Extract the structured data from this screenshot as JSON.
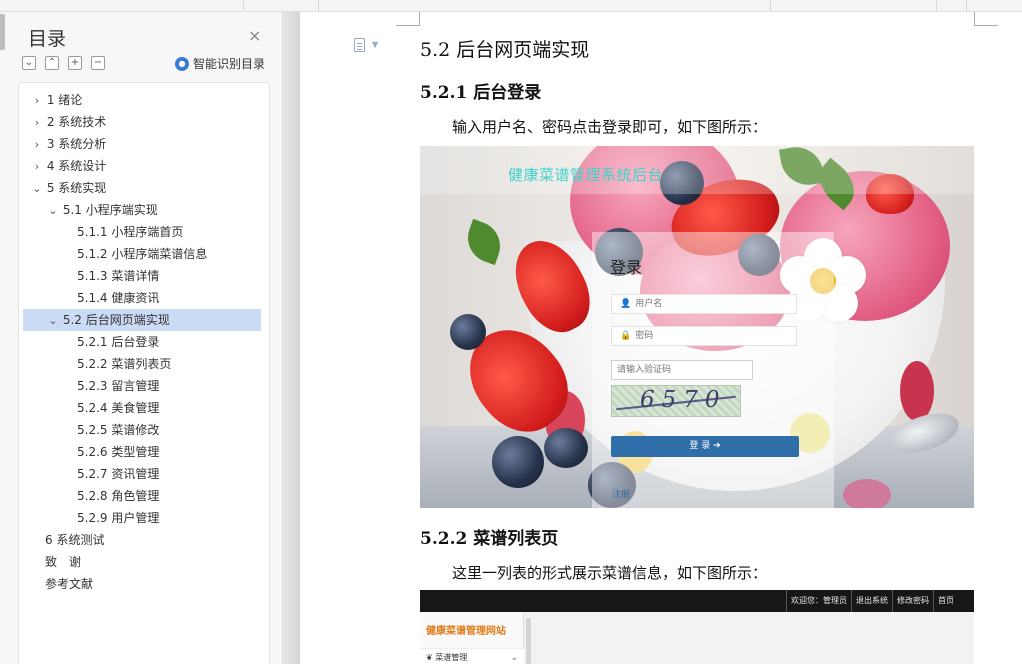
{
  "sidebar": {
    "title": "目录",
    "close_label": "×",
    "tools": [
      "⌄",
      "⌃",
      "+",
      "−"
    ],
    "smart_label": "智能识别目录",
    "smart_icon": "ai-icon",
    "items": [
      {
        "label": "1 绪论",
        "arrow": "›"
      },
      {
        "label": "2 系统技术",
        "arrow": "›"
      },
      {
        "label": "3 系统分析",
        "arrow": "›"
      },
      {
        "label": "4 系统设计",
        "arrow": "›"
      },
      {
        "label": "5 系统实现",
        "arrow": "⌄"
      },
      {
        "label": "5.1 小程序端实现",
        "arrow": "⌄"
      },
      {
        "label": "5.1.1 小程序端首页",
        "arrow": ""
      },
      {
        "label": "5.1.2 小程序端菜谱信息",
        "arrow": ""
      },
      {
        "label": "5.1.3 菜谱详情",
        "arrow": ""
      },
      {
        "label": "5.1.4 健康资讯",
        "arrow": ""
      },
      {
        "label": "5.2 后台网页端实现",
        "arrow": "⌄",
        "active": true
      },
      {
        "label": "5.2.1 后台登录",
        "arrow": ""
      },
      {
        "label": "5.2.2 菜谱列表页",
        "arrow": ""
      },
      {
        "label": "5.2.3 留言管理",
        "arrow": ""
      },
      {
        "label": "5.2.4 美食管理",
        "arrow": ""
      },
      {
        "label": "5.2.5 菜谱修改",
        "arrow": ""
      },
      {
        "label": "5.2.6 类型管理",
        "arrow": ""
      },
      {
        "label": "5.2.7 资讯管理",
        "arrow": ""
      },
      {
        "label": "5.2.8 角色管理",
        "arrow": ""
      },
      {
        "label": "5.2.9 用户管理",
        "arrow": ""
      },
      {
        "label": "6 系统测试",
        "arrow": ""
      },
      {
        "label": "致　谢",
        "arrow": ""
      },
      {
        "label": "参考文献",
        "arrow": ""
      }
    ]
  },
  "doc": {
    "heading_52": "5.2 后台网页端实现",
    "heading_521": "5.2.1 后台登录",
    "para_521": "输入用户名、密码点击登录即可，如下图所示：",
    "heading_522": "5.2.2 菜谱列表页",
    "para_522": "这里一列表的形式展示菜谱信息，如下图所示："
  },
  "login_shot": {
    "site_title": "健康菜谱管理系统后台",
    "login_title": "登录",
    "username_placeholder": "用户名",
    "password_placeholder": "密码",
    "captcha_placeholder": "请输入验证码",
    "captcha_text": "6570",
    "login_button": "登 录 ➔",
    "register_link": "注册"
  },
  "list_shot": {
    "nav": [
      "欢迎您：管理员",
      "退出系统",
      "修改密码",
      "首页"
    ],
    "brand": "健康菜谱管理网站",
    "menu_item": "菜谱管理"
  },
  "colors": {
    "accent": "#2f6ea9",
    "toc_active": "#c9dbf5",
    "site_title": "#3fd2c9",
    "brand": "#e07c1a"
  }
}
